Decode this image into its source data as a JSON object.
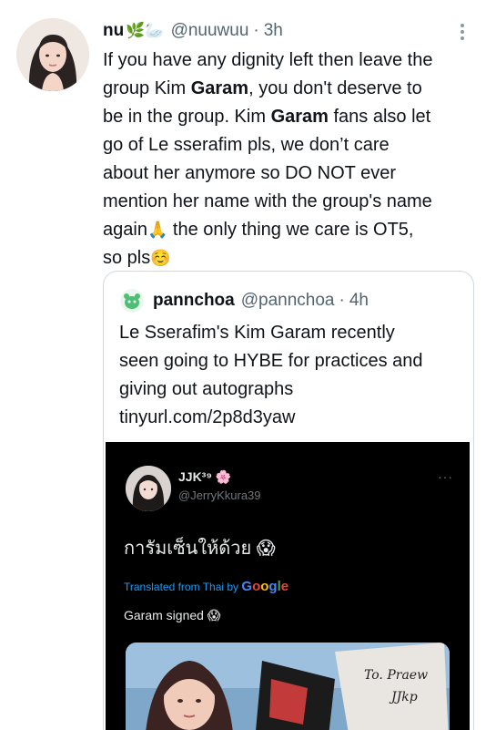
{
  "tweet": {
    "display_name": "nu",
    "name_emoji": "🌿🦢",
    "handle": "@nuuwuu",
    "separator": "·",
    "time": "3h",
    "body_lines": {
      "l1": "If you have any dignity left then leave the",
      "l2a": "group Kim ",
      "l2b": "Garam",
      "l2c": ", you don't deserve to",
      "l3a": "be in the group. Kim ",
      "l3b": "Garam",
      "l3c": " fans also let",
      "l4": "go of Le sserafim pls, we don’t care",
      "l5": "about her anymore so DO NOT ever",
      "l6": "mention her name with the group's name",
      "l7a": "again",
      "l7emoji": "🙏",
      "l7b": " the only thing we care is OT5,",
      "l8a": "so pls",
      "l8emoji": "☺️"
    }
  },
  "quote": {
    "display_name": "pannchoa",
    "handle": "@pannchoa",
    "separator": "·",
    "time": "4h",
    "text_lines": {
      "l1": "Le Sserafim's Kim Garam recently",
      "l2": "seen going to HYBE for practices and",
      "l3": "giving out autographs",
      "l4": "tinyurl.com/2p8d3yaw"
    }
  },
  "embedded": {
    "name": "JJK³⁹ 🌸",
    "handle": "@JerryKkura39",
    "dots": "···",
    "thai_text": "การัมเซ็นให้ด้วย 😱",
    "translated_prefix": "Translated from Thai by ",
    "google": {
      "G": "G",
      "o1": "o",
      "o2": "o",
      "g": "g",
      "l": "l",
      "e": "e"
    },
    "caption": "Garam signed 😱",
    "handwriting_1": "To. Praew",
    "handwriting_2": "JJkp"
  },
  "colors": {
    "text_primary": "#0f1419",
    "text_secondary": "#536471",
    "border": "#cfd9de",
    "link_blue": "#1d9bf0"
  },
  "icons": {
    "more": "more-vertical-icon"
  }
}
